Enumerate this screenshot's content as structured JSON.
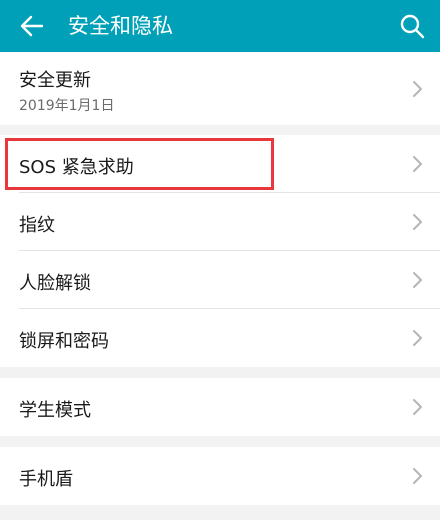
{
  "header": {
    "title": "安全和隐私",
    "back_icon": "arrow-left-icon",
    "search_icon": "search-icon",
    "bg_color": "#00a1b8"
  },
  "items": [
    {
      "label": "安全更新",
      "sub": "2019年1月1日"
    },
    {
      "label": "SOS 紧急求助"
    },
    {
      "label": "指纹"
    },
    {
      "label": "人脸解锁"
    },
    {
      "label": "锁屏和密码"
    },
    {
      "label": "学生模式"
    },
    {
      "label": "手机盾"
    }
  ],
  "highlight_color": "#e8383d"
}
